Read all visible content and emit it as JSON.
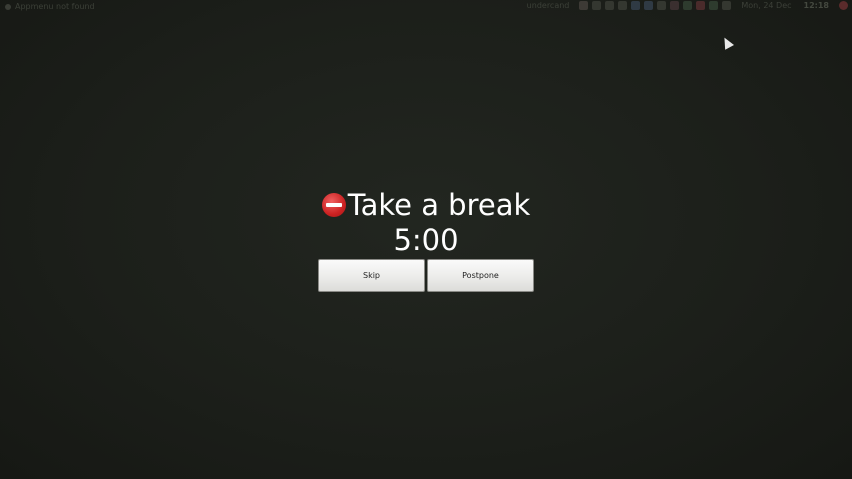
{
  "topbar": {
    "app_status": "Appmenu not found",
    "keyboard_layout": "undercand",
    "date": "Mon, 24 Dec",
    "time": "12:18"
  },
  "break_dialog": {
    "icon": "stop-icon",
    "title": "Take a break",
    "countdown": "5:00",
    "skip_label": "Skip",
    "postpone_label": "Postpone"
  },
  "colors": {
    "background": "#1c1f1a",
    "button_face": "#ececea",
    "text": "#ffffff"
  }
}
